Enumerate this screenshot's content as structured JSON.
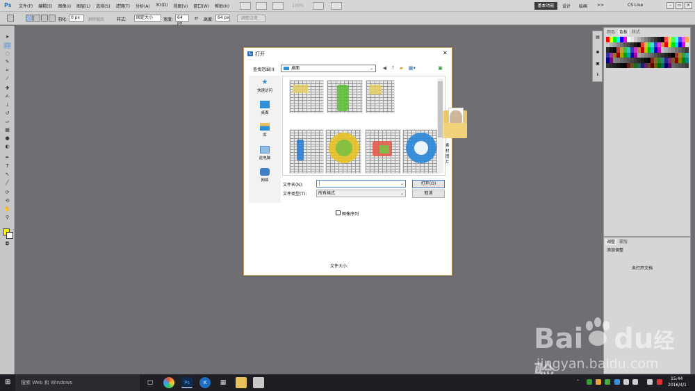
{
  "app": {
    "logo": "Ps",
    "menus": [
      "文件(F)",
      "编辑(E)",
      "图像(I)",
      "图层(L)",
      "选择(S)",
      "滤镜(T)",
      "分析(A)",
      "3D(D)",
      "视图(V)",
      "窗口(W)",
      "帮助(H)"
    ],
    "zoom": "100%",
    "workspaces": [
      "基本功能",
      "设计",
      "绘画"
    ],
    "more": ">>",
    "cslive": "CS Live"
  },
  "options": {
    "feather_label": "羽化:",
    "feather_value": "0 px",
    "antialias": "消除锯齿",
    "style_label": "样式:",
    "style_value": "固定大小",
    "width_label": "宽度:",
    "width_value": "64 px",
    "height_label": "高度:",
    "height_value": "64 px",
    "refine_edge": "调整边缘..."
  },
  "panels": {
    "swatch_tabs": [
      "颜色",
      "色板",
      "样式"
    ],
    "adjust_tabs": [
      "调整",
      "蒙版"
    ],
    "adjust_title": "添加调整",
    "adjust_msg": "未打开文档",
    "swatch_colors": [
      "#ff0000",
      "#ffff00",
      "#00ff00",
      "#00ffff",
      "#0000ff",
      "#ff00ff",
      "#ffffff",
      "#e6e6e6",
      "#cccccc",
      "#b3b3b3",
      "#999999",
      "#808080",
      "#666666",
      "#4d4d4d",
      "#333333",
      "#1a1a1a",
      "#000000",
      "#ff4d4d",
      "#ffd24d",
      "#4dff4d",
      "#4dffff",
      "#4d4dff",
      "#ff4dff",
      "#ffa64d"
    ]
  },
  "dialog": {
    "title": "打开",
    "look_in_label": "查找范围(I):",
    "look_in_value": "桌面",
    "places": [
      "快速访问",
      "桌面",
      "库",
      "此电脑",
      "网络"
    ],
    "folder_name": "素材图片",
    "file_name_label": "文件名(N):",
    "file_name_value": "",
    "file_type_label": "文件类型(T):",
    "file_type_value": "所有格式",
    "open_button": "打开(O)",
    "cancel_button": "取消",
    "image_sequence": "图像序列",
    "file_size_label": "文件大小:"
  },
  "taskbar": {
    "search_placeholder": "搜索 Web 和 Windows",
    "time": "15:44",
    "date": "2016/4/1"
  },
  "watermark": {
    "brand": "Bai",
    "brand2": "du",
    "brand_cn": "经验",
    "url": "jingyan.baidu.com"
  }
}
